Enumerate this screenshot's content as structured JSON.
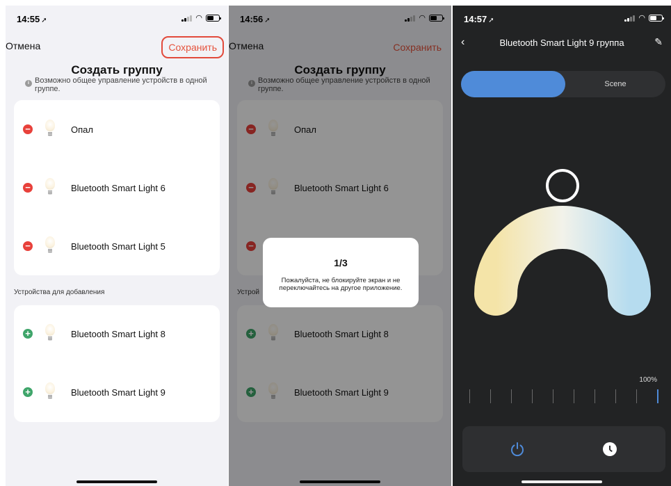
{
  "panels": [
    {
      "status": {
        "time": "14:55"
      },
      "nav": {
        "cancel": "Отмена",
        "save": "Сохранить"
      },
      "title": "Создать группу",
      "hint": "Возможно общее управление устройств в одной группе.",
      "group_devices": [
        "Опал",
        "Bluetooth Smart Light 6",
        "Bluetooth Smart Light 5"
      ],
      "section_label": "Устройства для добавления",
      "add_devices": [
        "Bluetooth Smart Light 8",
        "Bluetooth Smart Light 9"
      ]
    },
    {
      "status": {
        "time": "14:56"
      },
      "nav": {
        "cancel": "Отмена",
        "save": "Сохранить"
      },
      "title": "Создать группу",
      "hint": "Возможно общее управление устройств в одной группе.",
      "group_devices": [
        "Опал",
        "Bluetooth Smart Light 6",
        ""
      ],
      "section_label": "Устрой",
      "add_devices": [
        "Bluetooth Smart Light 8",
        "Bluetooth Smart Light 9"
      ],
      "dialog": {
        "count": "1/3",
        "message": "Пожалуйста, не блокируйте экран и не переключайтесь на другое приложение."
      }
    },
    {
      "status": {
        "time": "14:57"
      },
      "title": "Bluetooth Smart Light 9 группа",
      "tabs": {
        "white": "",
        "scene": "Scene"
      },
      "brightness_label": "100%",
      "brightness": 1.0,
      "color_temp_position": 0.5
    }
  ],
  "icons": {
    "remove": "minus-circle-icon",
    "add": "plus-circle-icon",
    "bulb": "light-bulb-icon",
    "info": "info-icon",
    "back": "chevron-left-icon",
    "edit": "edit-pencil-icon",
    "power": "power-icon",
    "timer": "clock-icon"
  },
  "colors": {
    "accent_red": "#e5533d",
    "remove": "#e8413b",
    "add": "#3fa56a",
    "blue": "#4f8bd9",
    "dark_bg": "#222324"
  }
}
